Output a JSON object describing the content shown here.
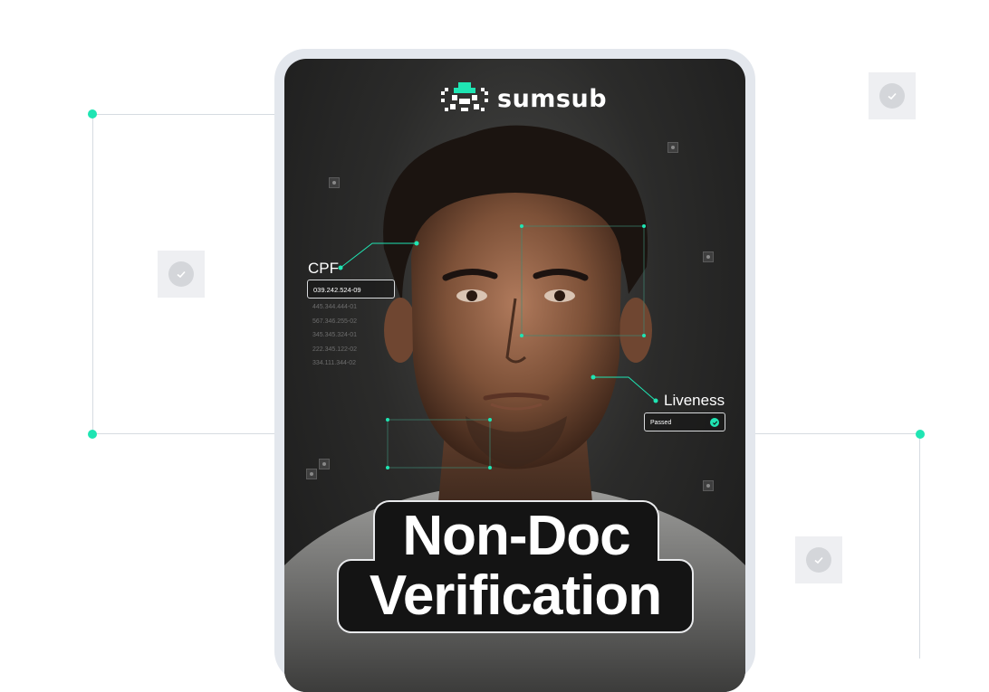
{
  "brand": {
    "name": "sumsub"
  },
  "headline": {
    "line1": "Non-Doc",
    "line2": "Verification"
  },
  "cpf": {
    "label": "CPF",
    "value": "039.242.524-09",
    "faded_values": [
      "445.344.444-01",
      "567.346.255-02",
      "345.345.324-01",
      "222.345.122-02",
      "334.111.344-02"
    ]
  },
  "liveness": {
    "label": "Liveness",
    "status": "Passed"
  },
  "colors": {
    "accent": "#1fe5b3",
    "tile": "#eeeff2",
    "device_frame": "#e3e7ed"
  },
  "icons": {
    "check": "check-icon",
    "logo": "sumsub-logo-icon"
  }
}
